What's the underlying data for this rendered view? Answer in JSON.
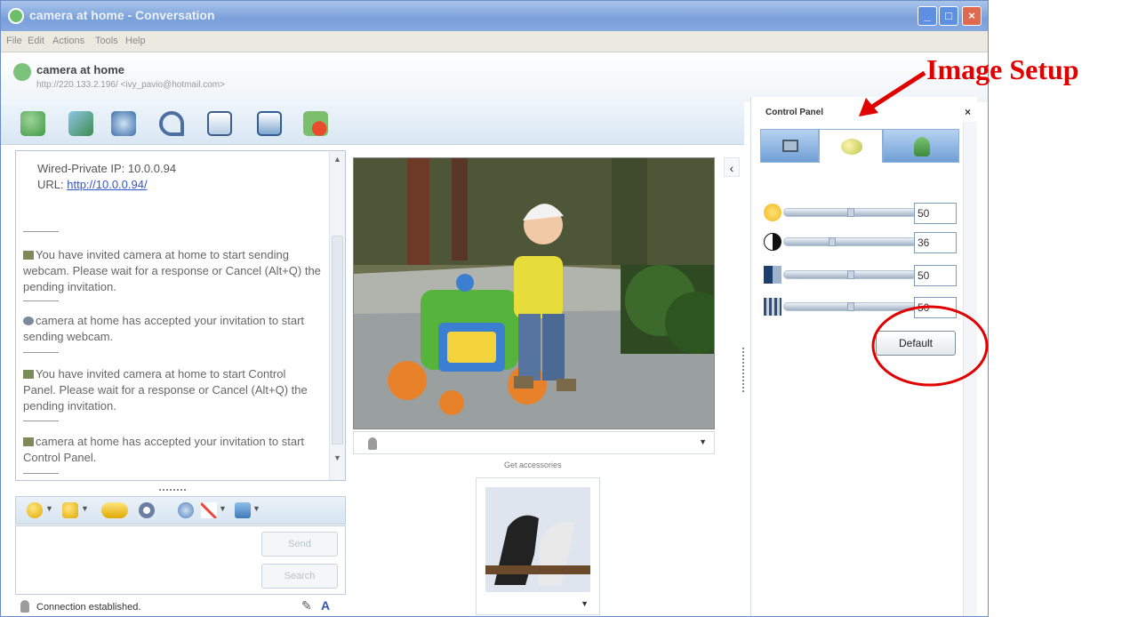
{
  "window": {
    "title": "camera at home - Conversation"
  },
  "menu": {
    "items": [
      "File",
      "Edit",
      "Actions",
      "Tools",
      "Help"
    ]
  },
  "contact": {
    "name": "camera at home",
    "address": "http://220.133.2.196/ <ivy_pavio@hotmail.com>"
  },
  "toolbar": {
    "icons": [
      "invite-icon",
      "photo-share-icon",
      "webcam-icon",
      "call-icon",
      "send-file-icon",
      "activities-icon",
      "block-icon"
    ]
  },
  "history": {
    "info_ip": "Wired-Private IP: 10.0.0.94",
    "info_url_label": "URL: ",
    "info_url": "http://10.0.0.94/",
    "messages": [
      "You have invited camera at home to start sending webcam. Please wait for a response or Cancel (Alt+Q) the pending invitation.",
      "camera at home has accepted your invitation to start sending webcam.",
      "You have invited camera at home to start Control Panel. Please wait for a response or Cancel (Alt+Q) the pending invitation.",
      "camera at home has accepted your invitation to start Control Panel."
    ]
  },
  "compose": {
    "send_label": "Send",
    "search_label": "Search"
  },
  "status": {
    "text": "Connection established."
  },
  "accessories": {
    "label": "Get accessories"
  },
  "control_panel": {
    "title": "Control Panel",
    "tabs": [
      "camera-tab",
      "image-setup-tab",
      "user-tab"
    ],
    "sliders": [
      {
        "name": "brightness",
        "icon": "brightness-icon",
        "value": "50",
        "level": 0.5
      },
      {
        "name": "contrast",
        "icon": "contrast-icon",
        "value": "36",
        "level": 0.36
      },
      {
        "name": "saturation",
        "icon": "saturation-icon",
        "value": "50",
        "level": 0.5
      },
      {
        "name": "sharpness",
        "icon": "sharpness-icon",
        "value": "50",
        "level": 0.5
      }
    ],
    "default_label": "Default"
  },
  "annotation": {
    "label": "Image Setup",
    "color": "#e00000"
  }
}
